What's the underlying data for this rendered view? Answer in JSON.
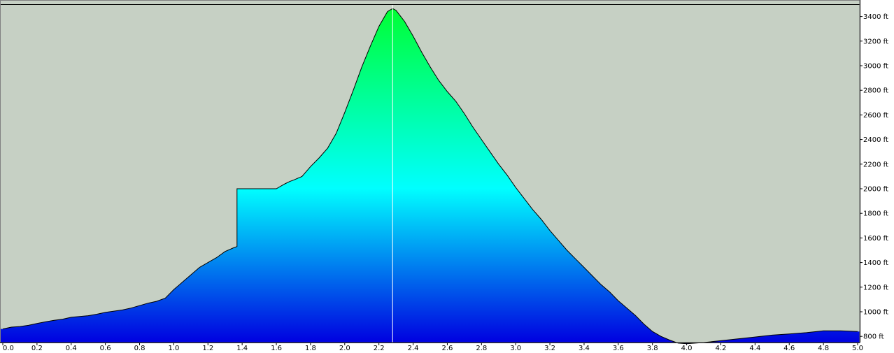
{
  "colors": {
    "background": "#c6d0c4",
    "fill_top": "#00ff2a",
    "fill_mid": "#00ffff",
    "fill_bottom": "#0000e0",
    "outline": "#000000",
    "cursor": "#ffffff"
  },
  "chart_data": {
    "type": "area",
    "title": "",
    "xlabel": "",
    "ylabel": "",
    "xlim": [
      0.0,
      5.0
    ],
    "ylim": [
      750,
      3500
    ],
    "grid": false,
    "legend": "none",
    "x_ticks": [
      {
        "value": 0.0,
        "label": "0.0"
      },
      {
        "value": 0.2,
        "label": "0.2"
      },
      {
        "value": 0.4,
        "label": "0.4"
      },
      {
        "value": 0.6,
        "label": "0.6"
      },
      {
        "value": 0.8,
        "label": "0.8"
      },
      {
        "value": 1.0,
        "label": "1.0"
      },
      {
        "value": 1.2,
        "label": "1.2"
      },
      {
        "value": 1.4,
        "label": "1.4"
      },
      {
        "value": 1.6,
        "label": "1.6"
      },
      {
        "value": 1.8,
        "label": "1.8"
      },
      {
        "value": 2.0,
        "label": "2.0"
      },
      {
        "value": 2.2,
        "label": "2.2"
      },
      {
        "value": 2.4,
        "label": "2.4"
      },
      {
        "value": 2.6,
        "label": "2.6"
      },
      {
        "value": 2.8,
        "label": "2.8"
      },
      {
        "value": 3.0,
        "label": "3.0"
      },
      {
        "value": 3.2,
        "label": "3.2"
      },
      {
        "value": 3.4,
        "label": "3.4"
      },
      {
        "value": 3.6,
        "label": "3.6"
      },
      {
        "value": 3.8,
        "label": "3.8"
      },
      {
        "value": 4.0,
        "label": "4.0"
      },
      {
        "value": 4.2,
        "label": "4.2"
      },
      {
        "value": 4.4,
        "label": "4.4"
      },
      {
        "value": 4.6,
        "label": "4.6"
      },
      {
        "value": 4.8,
        "label": "4.8"
      },
      {
        "value": 5.0,
        "label": "5.0"
      }
    ],
    "y_ticks": [
      {
        "value": 800,
        "label": "800 ft"
      },
      {
        "value": 1000,
        "label": "1000 ft"
      },
      {
        "value": 1200,
        "label": "1200 ft"
      },
      {
        "value": 1400,
        "label": "1400 ft"
      },
      {
        "value": 1600,
        "label": "1600 ft"
      },
      {
        "value": 1800,
        "label": "1800 ft"
      },
      {
        "value": 2000,
        "label": "2000 ft"
      },
      {
        "value": 2200,
        "label": "2200 ft"
      },
      {
        "value": 2400,
        "label": "2400 ft"
      },
      {
        "value": 2600,
        "label": "2600 ft"
      },
      {
        "value": 2800,
        "label": "2800 ft"
      },
      {
        "value": 3000,
        "label": "3000 ft"
      },
      {
        "value": 3200,
        "label": "3200 ft"
      },
      {
        "value": 3400,
        "label": "3400 ft"
      }
    ],
    "cursor_x": 2.28,
    "series": [
      {
        "x": [
          0.0,
          0.05,
          0.1,
          0.15,
          0.2,
          0.25,
          0.3,
          0.35,
          0.4,
          0.45,
          0.5,
          0.55,
          0.6,
          0.65,
          0.7,
          0.75,
          0.8,
          0.85,
          0.9,
          0.95,
          1.0,
          1.05,
          1.1,
          1.15,
          1.2,
          1.25,
          1.3,
          1.35,
          1.37,
          1.37,
          1.4,
          1.45,
          1.5,
          1.55,
          1.6,
          1.65,
          1.68,
          1.7,
          1.75,
          1.8,
          1.85,
          1.9,
          1.95,
          2.0,
          2.05,
          2.1,
          2.15,
          2.2,
          2.25,
          2.28,
          2.3,
          2.35,
          2.4,
          2.45,
          2.5,
          2.55,
          2.6,
          2.65,
          2.7,
          2.75,
          2.8,
          2.85,
          2.9,
          2.95,
          3.0,
          3.05,
          3.1,
          3.15,
          3.2,
          3.25,
          3.3,
          3.35,
          3.4,
          3.45,
          3.5,
          3.55,
          3.6,
          3.65,
          3.7,
          3.75,
          3.8,
          3.85,
          3.9,
          3.95,
          4.0,
          4.05,
          4.1,
          4.2,
          4.3,
          4.4,
          4.5,
          4.6,
          4.7,
          4.8,
          4.9,
          5.0
        ],
        "y": [
          860,
          875,
          880,
          890,
          905,
          918,
          930,
          940,
          955,
          962,
          968,
          980,
          995,
          1005,
          1015,
          1030,
          1050,
          1070,
          1085,
          1110,
          1180,
          1240,
          1300,
          1360,
          1400,
          1440,
          1490,
          1520,
          1530,
          2000,
          2000,
          2000,
          2000,
          2000,
          2000,
          2040,
          2060,
          2070,
          2100,
          2180,
          2250,
          2330,
          2450,
          2620,
          2800,
          2990,
          3160,
          3320,
          3440,
          3465,
          3450,
          3360,
          3240,
          3110,
          2990,
          2880,
          2790,
          2710,
          2610,
          2500,
          2400,
          2300,
          2200,
          2110,
          2010,
          1920,
          1830,
          1750,
          1660,
          1580,
          1500,
          1430,
          1360,
          1290,
          1220,
          1160,
          1090,
          1030,
          970,
          900,
          840,
          800,
          770,
          745,
          740,
          745,
          750,
          765,
          780,
          795,
          810,
          820,
          830,
          845,
          845,
          840
        ]
      }
    ]
  }
}
